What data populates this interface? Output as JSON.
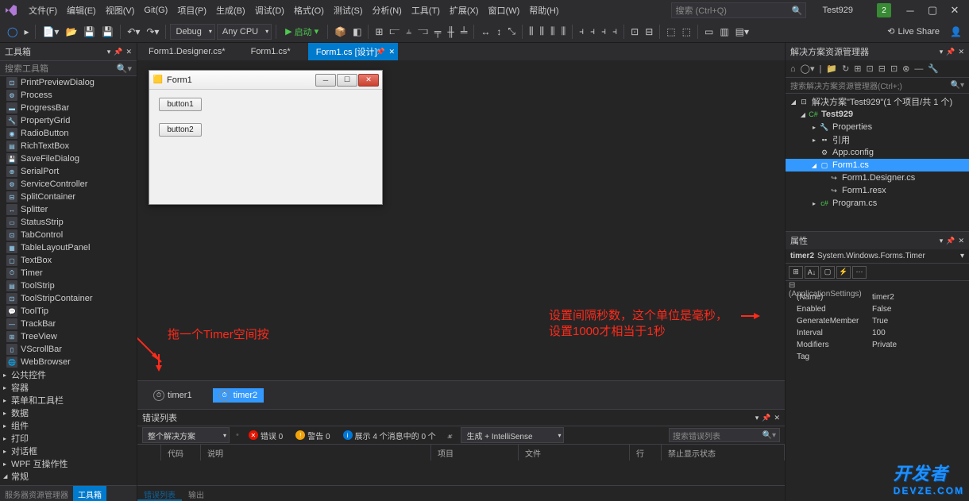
{
  "menu": {
    "items": [
      "文件(F)",
      "编辑(E)",
      "视图(V)",
      "Git(G)",
      "项目(P)",
      "生成(B)",
      "调试(D)",
      "格式(O)",
      "测试(S)",
      "分析(N)",
      "工具(T)",
      "扩展(X)",
      "窗口(W)",
      "帮助(H)"
    ],
    "search_placeholder": "搜索 (Ctrl+Q)",
    "project_name": "Test929",
    "notif_count": "2"
  },
  "toolbar": {
    "config": "Debug",
    "platform": "Any CPU",
    "start": "启动",
    "liveshare": "Live Share"
  },
  "tabs": {
    "items": [
      {
        "label": "Form1.Designer.cs*",
        "active": false
      },
      {
        "label": "Form1.cs*",
        "active": false
      },
      {
        "label": "Form1.cs [设计]*",
        "active": true
      }
    ]
  },
  "toolbox": {
    "title": "工具箱",
    "search": "搜索工具箱",
    "items": [
      "PrintPreviewDialog",
      "Process",
      "ProgressBar",
      "PropertyGrid",
      "RadioButton",
      "RichTextBox",
      "SaveFileDialog",
      "SerialPort",
      "ServiceController",
      "SplitContainer",
      "Splitter",
      "StatusStrip",
      "TabControl",
      "TableLayoutPanel",
      "TextBox",
      "Timer",
      "ToolStrip",
      "ToolStripContainer",
      "ToolTip",
      "TrackBar",
      "TreeView",
      "VScrollBar",
      "WebBrowser"
    ],
    "categories": [
      "公共控件",
      "容器",
      "菜单和工具栏",
      "数据",
      "组件",
      "打印",
      "对话框",
      "WPF 互操作性",
      "常规"
    ],
    "bottom_tabs": {
      "a": "服务器资源管理器",
      "b": "工具箱"
    }
  },
  "form": {
    "title": "Form1",
    "btn1": "button1",
    "btn2": "button2"
  },
  "tray": {
    "t1": "timer1",
    "t2": "timer2"
  },
  "annotations": {
    "left": "拖一个Timer空间按",
    "right1": "设置间隔秒数，这个单位是毫秒，",
    "right2": "设置1000才相当于1秒"
  },
  "errorlist": {
    "title": "错误列表",
    "scope": "整个解决方案",
    "errors": "错误 0",
    "warnings": "警告 0",
    "messages": "展示 4 个消息中的 0 个",
    "source": "生成 + IntelliSense",
    "search": "搜索错误列表",
    "cols": {
      "code": "代码",
      "desc": "说明",
      "project": "项目",
      "file": "文件",
      "line": "行",
      "suppress": "禁止显示状态"
    },
    "output_tabs": {
      "a": "错误列表",
      "b": "输出"
    }
  },
  "solution": {
    "title": "解决方案资源管理器",
    "search": "搜索解决方案资源管理器(Ctrl+;)",
    "root": "解决方案\"Test929\"(1 个项目/共 1 个)",
    "nodes": {
      "project": "Test929",
      "properties": "Properties",
      "refs": "引用",
      "appconfig": "App.config",
      "form": "Form1.cs",
      "designer": "Form1.Designer.cs",
      "resx": "Form1.resx",
      "program": "Program.cs"
    }
  },
  "properties": {
    "title": "属性",
    "object_name": "timer2",
    "object_type": "System.Windows.Forms.Timer",
    "category": "(ApplicationSettings)",
    "rows": [
      {
        "k": "(Name)",
        "v": "timer2"
      },
      {
        "k": "Enabled",
        "v": "False"
      },
      {
        "k": "GenerateMember",
        "v": "True"
      },
      {
        "k": "Interval",
        "v": "100"
      },
      {
        "k": "Modifiers",
        "v": "Private"
      },
      {
        "k": "Tag",
        "v": ""
      }
    ]
  },
  "watermark": {
    "big": "开发者",
    "small": "DEVZE.COM"
  }
}
